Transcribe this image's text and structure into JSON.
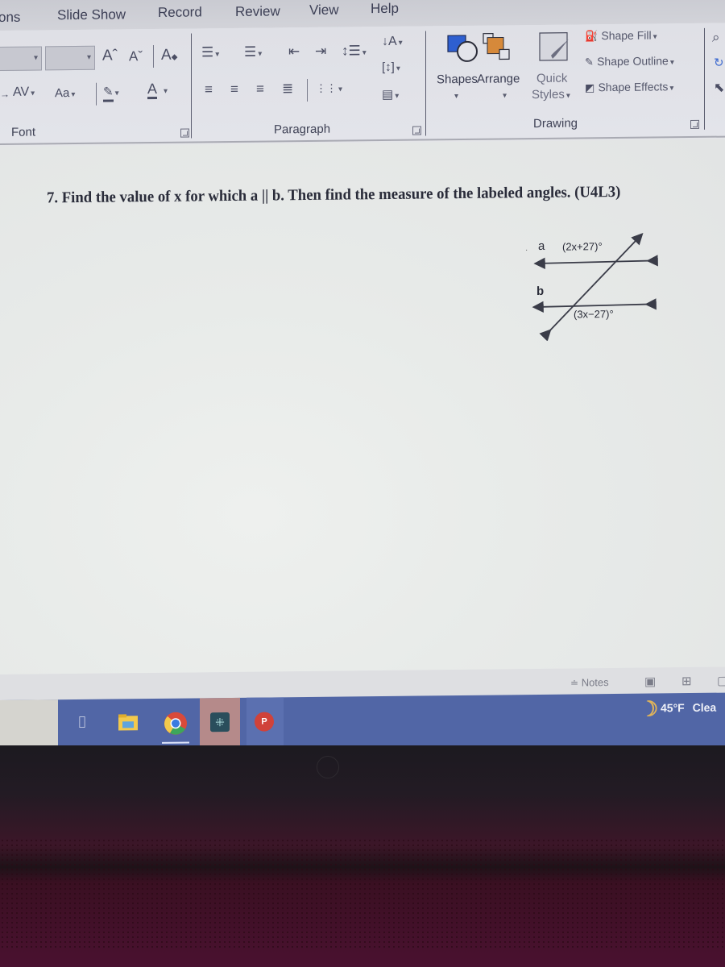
{
  "menubar": {
    "tabs": [
      "ons",
      "Slide Show",
      "Record",
      "Review",
      "View",
      "Help"
    ]
  },
  "ribbon": {
    "font_group": {
      "label": "Font",
      "font_name_value": "",
      "font_size_value": "",
      "increase_font": "Aˆ",
      "decrease_font": "Aˇ",
      "clear_formatting": "A",
      "char_spacing": "AV",
      "change_case": "Aa",
      "font_color": "A"
    },
    "paragraph_group": {
      "label": "Paragraph"
    },
    "drawing_group": {
      "label": "Drawing",
      "shapes": "Shapes",
      "arrange": "Arrange",
      "quick_styles_line1": "Quick",
      "quick_styles_line2": "Styles",
      "shape_fill": "Shape Fill",
      "shape_outline": "Shape Outline",
      "shape_effects": "Shape Effects"
    }
  },
  "document": {
    "question": "7. Find the value of x for which a || b. Then find the measure of the labeled angles. (U4L3)",
    "diagram": {
      "line_a_label": "a",
      "line_b_label": "b",
      "angle_top": "(2x+27)°",
      "angle_bottom": "(3x−27)°"
    }
  },
  "statusbar": {
    "notes_label": "Notes"
  },
  "taskbar": {
    "apps": [
      "Task View",
      "File Explorer",
      "Google Chrome",
      "App",
      "PowerPoint"
    ],
    "weather_temp": "45°F",
    "weather_text": "Clea"
  },
  "colors": {
    "taskbar": "#5166a6",
    "shapes_blue": "#2e5fd0",
    "arrange_orange": "#d6893a",
    "weather_moon": "#e0b45a"
  }
}
